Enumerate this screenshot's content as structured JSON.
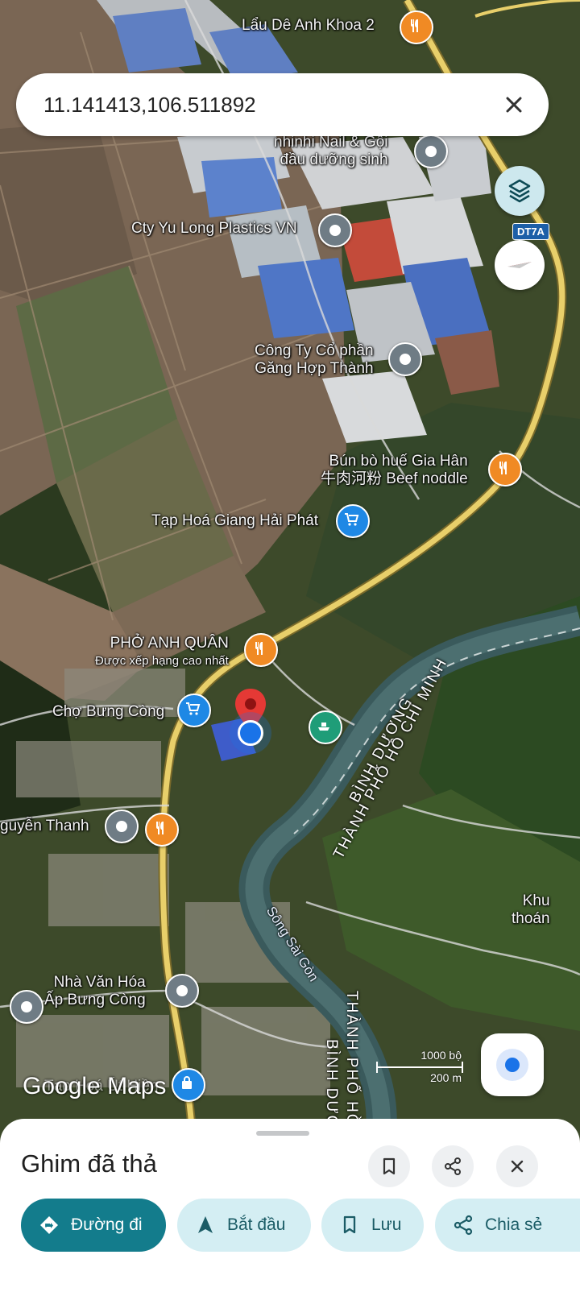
{
  "search": {
    "query": "11.141413,106.511892"
  },
  "map": {
    "pois": [
      {
        "name": "Lẩu Dê Anh Khoa 2",
        "type": "restaurant"
      },
      {
        "name": "nhinhi Nail & Gội",
        "sub": "đầu dưỡng sinh",
        "type": "place"
      },
      {
        "name": "Cty Yu Long Plastics VN",
        "type": "place"
      },
      {
        "name": "Công Ty Cổ phần",
        "sub": "Găng Hợp Thành",
        "type": "place"
      },
      {
        "name": "Bún bò huế Gia Hân",
        "sub": "牛肉河粉 Beef noddle",
        "type": "restaurant"
      },
      {
        "name": "Tạp Hoá Giang Hải Phát",
        "type": "shop"
      },
      {
        "name": "PHỞ ANH QUÂN",
        "sub": "Được xếp hạng cao nhất",
        "type": "restaurant"
      },
      {
        "name": "Chợ Bưng Còng",
        "type": "shop"
      },
      {
        "name": "guyễn Thanh",
        "type": "place"
      },
      {
        "name": "Nhà Văn Hóa",
        "sub": "Ấp Bưng Còng",
        "type": "place"
      },
      {
        "name": "Tạp Hoá Út Hiền",
        "type": "shop"
      },
      {
        "name": "Khu",
        "sub": "thoán",
        "type": "area"
      }
    ],
    "road_sign": "DT7A",
    "river": "Sông Sài Gòn",
    "admin": {
      "a1": "BÌNH DƯƠNG",
      "a2": "THÀNH PHỐ HỒ CHÍ MINH",
      "b1": "THÀNH PHỐ HỒ C",
      "b2": "BÌNH DƯƠ"
    },
    "scale": {
      "imperial": "1000 bộ",
      "metric": "200 m"
    },
    "logo": "Google Maps"
  },
  "sheet": {
    "title": "Ghim đã thả",
    "actions": [
      {
        "label": "Đường đi",
        "icon": "directions-icon"
      },
      {
        "label": "Bắt đầu",
        "icon": "navigation-arrow-icon"
      },
      {
        "label": "Lưu",
        "icon": "bookmark-icon"
      },
      {
        "label": "Chia sẻ",
        "icon": "share-icon"
      }
    ]
  },
  "colors": {
    "primary_teal": "#137c8c",
    "pill_bg": "#d4eef3",
    "pin_red": "#e53935",
    "restaurant_orange": "#f08a24",
    "shop_blue": "#1e88e5"
  }
}
